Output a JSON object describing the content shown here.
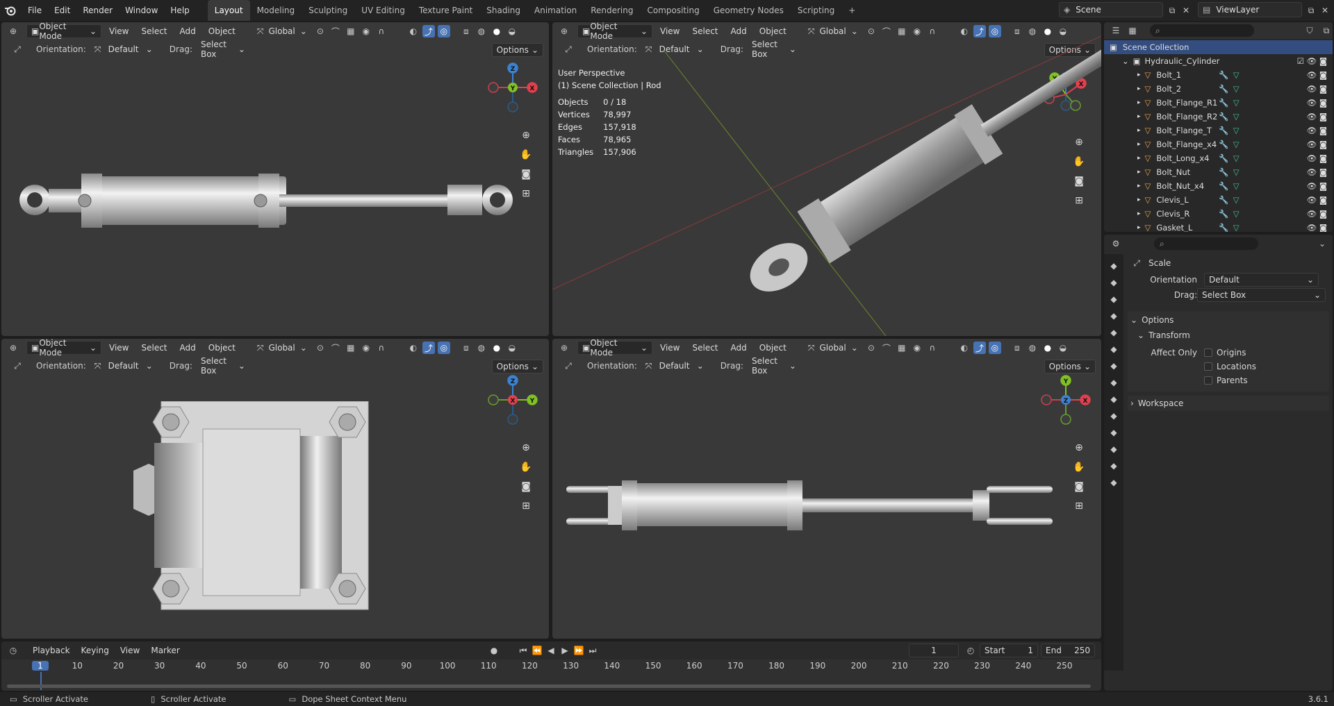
{
  "app": {
    "logo_icon": "blender-icon",
    "version": "3.6.1"
  },
  "menu": [
    "File",
    "Edit",
    "Render",
    "Window",
    "Help"
  ],
  "workspaces": [
    {
      "label": "Layout",
      "active": true
    },
    {
      "label": "Modeling"
    },
    {
      "label": "Sculpting"
    },
    {
      "label": "UV Editing"
    },
    {
      "label": "Texture Paint"
    },
    {
      "label": "Shading"
    },
    {
      "label": "Animation"
    },
    {
      "label": "Rendering"
    },
    {
      "label": "Compositing"
    },
    {
      "label": "Geometry Nodes"
    },
    {
      "label": "Scripting"
    },
    {
      "label": "+"
    }
  ],
  "scene": {
    "name": "Scene",
    "view_layer": "ViewLayer"
  },
  "viewport_header": {
    "mode": "Object Mode",
    "view": "View",
    "select": "Select",
    "add": "Add",
    "object": "Object",
    "transform": "Global"
  },
  "tool_header": {
    "orientation_label": "Orientation:",
    "orientation_value": "Default",
    "drag_label": "Drag:",
    "drag_value": "Select Box",
    "options": "Options"
  },
  "viewport_tr": {
    "perspective": "User Perspective",
    "collection": "(1) Scene Collection | Rod",
    "stats": [
      {
        "k": "Objects",
        "v": "0 / 18"
      },
      {
        "k": "Vertices",
        "v": "78,997"
      },
      {
        "k": "Edges",
        "v": "157,918"
      },
      {
        "k": "Faces",
        "v": "78,965"
      },
      {
        "k": "Triangles",
        "v": "157,906"
      }
    ]
  },
  "gizmo_axes": {
    "x": "X",
    "y": "Y",
    "z": "Z"
  },
  "outliner": {
    "root": "Scene Collection",
    "collection": "Hydraulic_Cylinder",
    "items": [
      "Bolt_1",
      "Bolt_2",
      "Bolt_Flange_R1",
      "Bolt_Flange_R2",
      "Bolt_Flange_T",
      "Bolt_Flange_x4",
      "Bolt_Long_x4",
      "Bolt_Nut",
      "Bolt_Nut_x4",
      "Clevis_L",
      "Clevis_R",
      "Gasket_L"
    ]
  },
  "properties": {
    "tool": "Scale",
    "orientation_label": "Orientation",
    "orientation_value": "Default",
    "drag_label": "Drag:",
    "drag_value": "Select Box",
    "options_panel": "Options",
    "transform_panel": "Transform",
    "affect_only": "Affect Only",
    "checks": [
      "Origins",
      "Locations",
      "Parents"
    ],
    "workspace_panel": "Workspace"
  },
  "timeline": {
    "menus": [
      "Playback",
      "Keying",
      "View",
      "Marker"
    ],
    "current_frame": "1",
    "start_label": "Start",
    "start": "1",
    "end_label": "End",
    "end": "250",
    "ticks": [
      "1",
      "10",
      "20",
      "30",
      "40",
      "50",
      "60",
      "70",
      "80",
      "90",
      "100",
      "110",
      "120",
      "130",
      "140",
      "150",
      "160",
      "170",
      "180",
      "190",
      "200",
      "210",
      "220",
      "230",
      "240",
      "250"
    ]
  },
  "status": {
    "left": "Scroller Activate",
    "middle": "Scroller Activate",
    "right": "Dope Sheet Context Menu"
  }
}
